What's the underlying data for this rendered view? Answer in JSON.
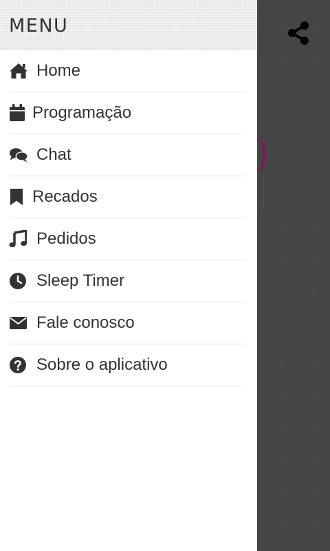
{
  "drawer": {
    "title": "MENU",
    "items": [
      {
        "label": "Home",
        "icon": "home-icon"
      },
      {
        "label": "Programação",
        "icon": "calendar-icon"
      },
      {
        "label": "Chat",
        "icon": "chat-icon"
      },
      {
        "label": "Recados",
        "icon": "bookmark-icon"
      },
      {
        "label": "Pedidos",
        "icon": "music-icon"
      },
      {
        "label": "Sleep Timer",
        "icon": "clock-icon"
      },
      {
        "label": "Fale conosco",
        "icon": "envelope-icon"
      },
      {
        "label": "Sobre o aplicativo",
        "icon": "question-icon"
      }
    ]
  },
  "toolbar": {
    "share_icon": "share-icon"
  },
  "colors": {
    "backdrop": "#454545",
    "accent": "#8a0f5f",
    "text": "#333333",
    "divider": "#e2e2e2"
  }
}
